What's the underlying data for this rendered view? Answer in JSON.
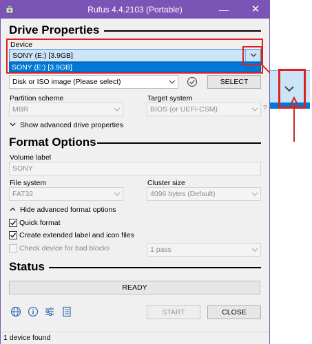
{
  "window": {
    "title": "Rufus 4.4.2103 (Portable)",
    "minimize_glyph": "—",
    "close_glyph": "✕"
  },
  "drive_properties": {
    "section_title": "Drive Properties",
    "device_label": "Device",
    "device_value": "SONY (E:) [3.9GB]",
    "device_dropdown_options": [
      "SONY (E:) [3.9GB]"
    ],
    "boot_selection_value": "Disk or ISO image (Please select)",
    "select_button": "SELECT",
    "partition_scheme_label": "Partition scheme",
    "partition_scheme_value": "MBR",
    "target_system_label": "Target system",
    "target_system_value": "BIOS (or UEFI-CSM)",
    "help_glyph": "?",
    "advanced_toggle": "Show advanced drive properties"
  },
  "format_options": {
    "section_title": "Format Options",
    "volume_label_label": "Volume label",
    "volume_label_value": "SONY",
    "file_system_label": "File system",
    "file_system_value": "FAT32",
    "cluster_size_label": "Cluster size",
    "cluster_size_value": "4096 bytes (Default)",
    "advanced_toggle": "Hide advanced format options",
    "quick_format": {
      "label": "Quick format",
      "checked": true
    },
    "extended_label": {
      "label": "Create extended label and icon files",
      "checked": true
    },
    "bad_blocks": {
      "label": "Check device for bad blocks",
      "checked": false,
      "passes": "1 pass"
    }
  },
  "status": {
    "section_title": "Status",
    "progress_text": "READY",
    "progress_fraction": 0
  },
  "footer": {
    "start_button": "START",
    "close_button": "CLOSE",
    "icons": [
      "globe-icon",
      "info-icon",
      "settings-sliders-icon",
      "log-icon"
    ]
  },
  "statusbar": {
    "text": "1 device found"
  },
  "colors": {
    "title_bar": "#7b54b5",
    "highlight_red": "#e02020",
    "selection_blue": "#0078d7",
    "dropdown_highlight_bg": "#cce4f7"
  }
}
